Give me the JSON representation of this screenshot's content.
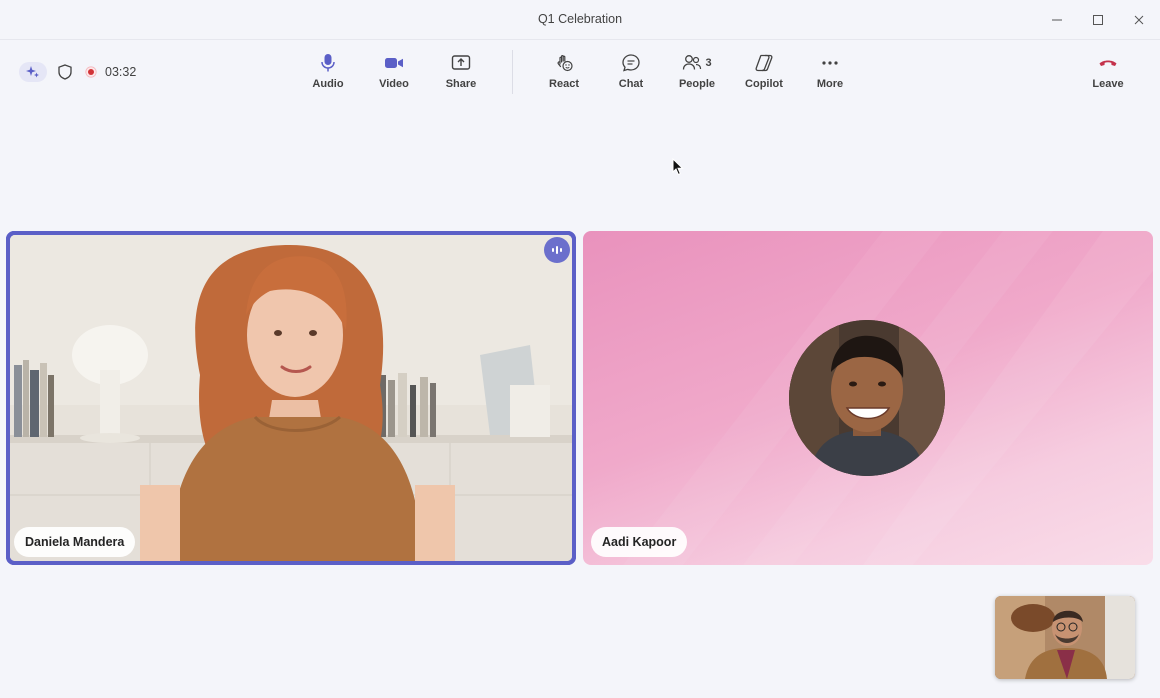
{
  "window": {
    "title": "Q1 Celebration",
    "controls": [
      "minimize-icon",
      "maximize-icon",
      "close-icon"
    ]
  },
  "status": {
    "copilot_icon": "copilot-sparkle-icon",
    "shield_icon": "shield-icon",
    "recording_icon": "recording-dot-icon",
    "timer": "03:32"
  },
  "toolbar": {
    "audio": {
      "label": "Audio",
      "icon": "microphone-icon"
    },
    "video": {
      "label": "Video",
      "icon": "video-camera-icon"
    },
    "share": {
      "label": "Share",
      "icon": "share-screen-icon"
    },
    "react": {
      "label": "React",
      "icon": "react-icon"
    },
    "chat": {
      "label": "Chat",
      "icon": "chat-icon"
    },
    "people": {
      "label": "People",
      "icon": "people-icon",
      "count": "3"
    },
    "copilot": {
      "label": "Copilot",
      "icon": "copilot-icon"
    },
    "more": {
      "label": "More",
      "icon": "more-icon"
    },
    "leave": {
      "label": "Leave",
      "icon": "hang-up-icon"
    }
  },
  "participants": [
    {
      "name": "Daniela Mandera",
      "speaking": true
    },
    {
      "name": "Aadi Kapoor",
      "speaking": false
    }
  ],
  "colors": {
    "accent": "#5b5fc7",
    "leave_red": "#c4314b",
    "recording_red": "#d13438",
    "tile_pink": "#f0a9ca"
  }
}
